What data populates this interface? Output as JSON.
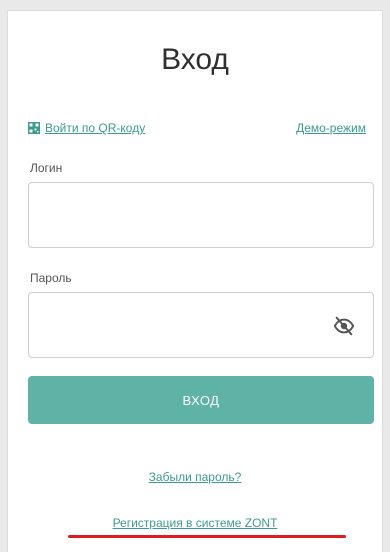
{
  "login_form": {
    "title": "Вход",
    "qr_login_label": "Войти по QR-коду",
    "demo_label": "Демо-режим",
    "login_label": "Логин",
    "login_value": "",
    "password_label": "Пароль",
    "password_value": "",
    "submit_label": "ВХОД",
    "forgot_label": "Забыли пароль?",
    "register_label": "Регистрация в системе ZONT"
  },
  "icons": {
    "qr": "qr-code-icon",
    "password_visibility": "eye-off-icon"
  },
  "colors": {
    "accent": "#3a9b90",
    "button": "#5fb3a6",
    "highlight": "#e01b1b"
  }
}
